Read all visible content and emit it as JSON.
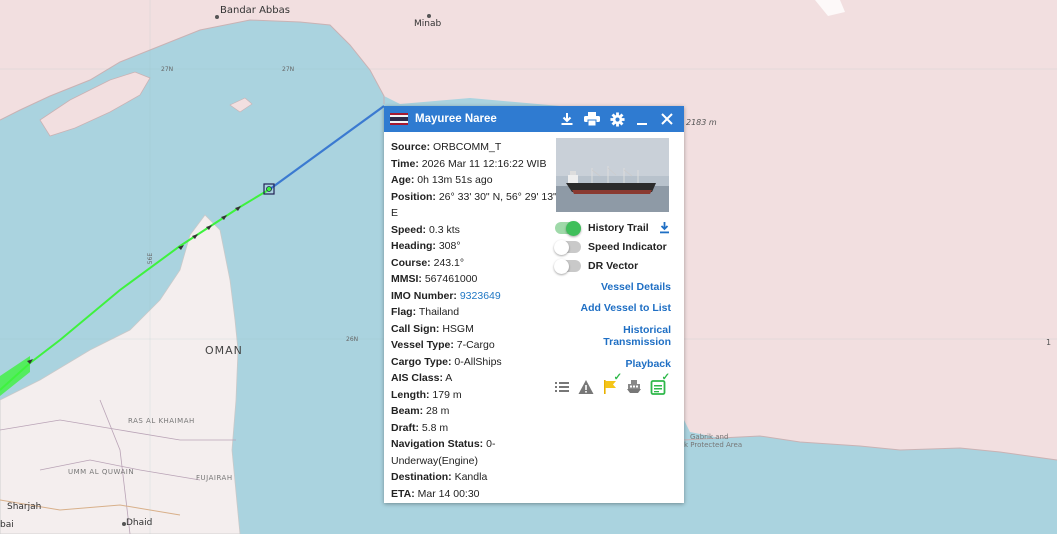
{
  "map": {
    "labels": {
      "bandar_abbas": "Bandar Abbas",
      "minab": "Minab",
      "lat_27n_a": "27N",
      "lat_27n_b": "27N",
      "lon_56e": "56E",
      "lat_26n": "26N",
      "oman": "OMAN",
      "depth": "2183 m",
      "ras_al_khaimah": "RAS AL KHAIMAH",
      "umm_al_quwain": "UMM AL QUWAIN",
      "fujairah": "FUJAIRAH",
      "sharjah": "Sharjah",
      "dubai": "bai",
      "dhaid": "Dhaid",
      "gabrik": "Gabrik and",
      "protected": "k Protected Area",
      "edge_number": "1"
    }
  },
  "popup": {
    "vessel_name": "Mayuree Naree",
    "flag_icon": "thailand-flag-icon",
    "header_icons": [
      "download-icon",
      "print-icon",
      "gear-icon",
      "minimize-icon",
      "close-icon"
    ],
    "details": [
      {
        "key": "Source:",
        "value": "ORBCOMM_T"
      },
      {
        "key": "Time:",
        "value": "2026 Mar 11 12:16:22 WIB"
      },
      {
        "key": "Age:",
        "value": "0h 13m 51s ago"
      },
      {
        "key": "Position:",
        "value": " 26° 33' 30\" N, 56° 29' 13\" E"
      },
      {
        "key": "Speed:",
        "value": "0.3 kts"
      },
      {
        "key": "Heading:",
        "value": "308°"
      },
      {
        "key": "Course:",
        "value": "243.1°"
      },
      {
        "key": "MMSI:",
        "value": "567461000"
      },
      {
        "key": "IMO Number:",
        "value": "9323649"
      },
      {
        "key": "Flag:",
        "value": "Thailand"
      },
      {
        "key": "Call Sign:",
        "value": "HSGM"
      },
      {
        "key": "Vessel Type:",
        "value": "7-Cargo"
      },
      {
        "key": "Cargo Type:",
        "value": "0-AllShips"
      },
      {
        "key": "AIS Class:",
        "value": "A"
      },
      {
        "key": "Length:",
        "value": "179 m"
      },
      {
        "key": "Beam:",
        "value": "28 m"
      },
      {
        "key": "Draft:",
        "value": "5.8 m"
      },
      {
        "key": "Navigation Status:",
        "value": "0-Underway(Engine)"
      },
      {
        "key": "Destination:",
        "value": "Kandla"
      },
      {
        "key": "ETA:",
        "value": "Mar 14 00:30"
      }
    ],
    "toggles": [
      {
        "label": "History Trail",
        "on": true
      },
      {
        "label": "Speed Indicator",
        "on": false
      },
      {
        "label": "DR Vector",
        "on": false
      }
    ],
    "links": {
      "vessel_details": "Vessel Details",
      "add_vessel": "Add Vessel to List",
      "historical": "Historical Transmission",
      "playback": "Playback"
    },
    "bottom_icons": [
      "list-icon",
      "warning-icon",
      "flag-icon",
      "ship-icon",
      "notes-icon"
    ],
    "colors": {
      "header": "#2f7bd1",
      "link": "#1f6fc4",
      "track_green": "#3ef23e",
      "track_blue": "#3b7ad1",
      "check": "#2eb84a"
    }
  }
}
